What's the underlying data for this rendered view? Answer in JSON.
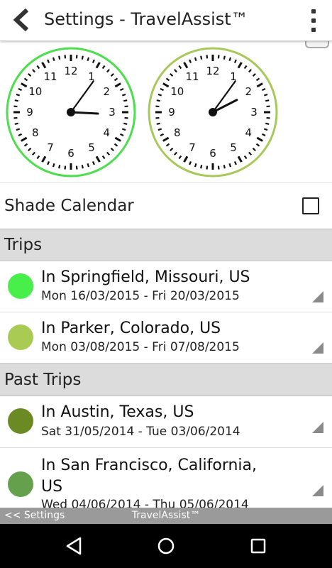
{
  "appbar": {
    "title": "Settings - TravelAssist™"
  },
  "clocks": {
    "numbers": [
      "12",
      "1",
      "2",
      "3",
      "4",
      "5",
      "6",
      "7",
      "8",
      "9",
      "10",
      "11"
    ],
    "left": {
      "ring_color": "#4cde4c",
      "hour": 3,
      "minute": 6
    },
    "right": {
      "ring_color": "#a8c95a",
      "hour": 2,
      "minute": 6
    }
  },
  "settings": {
    "shade_calendar_label": "Shade Calendar",
    "shade_calendar_checked": false
  },
  "sections": {
    "trips_header": "Trips",
    "past_trips_header": "Past Trips"
  },
  "trips": [
    {
      "title": "In Springfield, Missouri, US",
      "dates": "Mon 16/03/2015 - Fri 20/03/2015",
      "color": "#48ee4a"
    },
    {
      "title": "In Parker, Colorado, US",
      "dates": "Mon 03/08/2015 - Fri 07/08/2015",
      "color": "#a9cb54"
    }
  ],
  "past_trips": [
    {
      "title": "In Austin, Texas, US",
      "dates": "Sat 31/05/2014 - Tue 03/06/2014",
      "color": "#6c8a23"
    },
    {
      "title": "In San Francisco, California, US",
      "dates": "Wed 04/06/2014 - Thu 05/06/2014",
      "color": "#65a14d"
    }
  ],
  "statusbar": {
    "back_link": "<< Settings",
    "app_name": "TravelAssist™"
  },
  "icons": {
    "back": "back-arrow-icon",
    "menu": "more-vert-icon",
    "nav_back": "nav-back-icon",
    "nav_home": "nav-home-icon",
    "nav_recents": "nav-recents-icon"
  }
}
